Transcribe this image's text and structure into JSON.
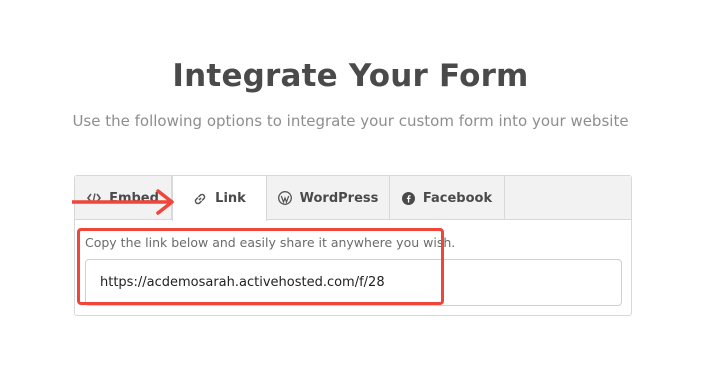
{
  "header": {
    "title": "Integrate Your Form",
    "subtitle": "Use the following options to integrate your custom form into your website"
  },
  "tabs": [
    {
      "label": "Embed",
      "icon": "code-icon",
      "active": false
    },
    {
      "label": "Link",
      "icon": "link-icon",
      "active": true
    },
    {
      "label": "WordPress",
      "icon": "wordpress-icon",
      "active": false
    },
    {
      "label": "Facebook",
      "icon": "facebook-icon",
      "active": false
    }
  ],
  "link_panel": {
    "instruction": "Copy the link below and easily share it anywhere you wish.",
    "url": "https://acdemosarah.activehosted.com/f/28"
  },
  "annotation": {
    "highlight_color": "#f0453a",
    "arrow_color": "#f0453a"
  }
}
